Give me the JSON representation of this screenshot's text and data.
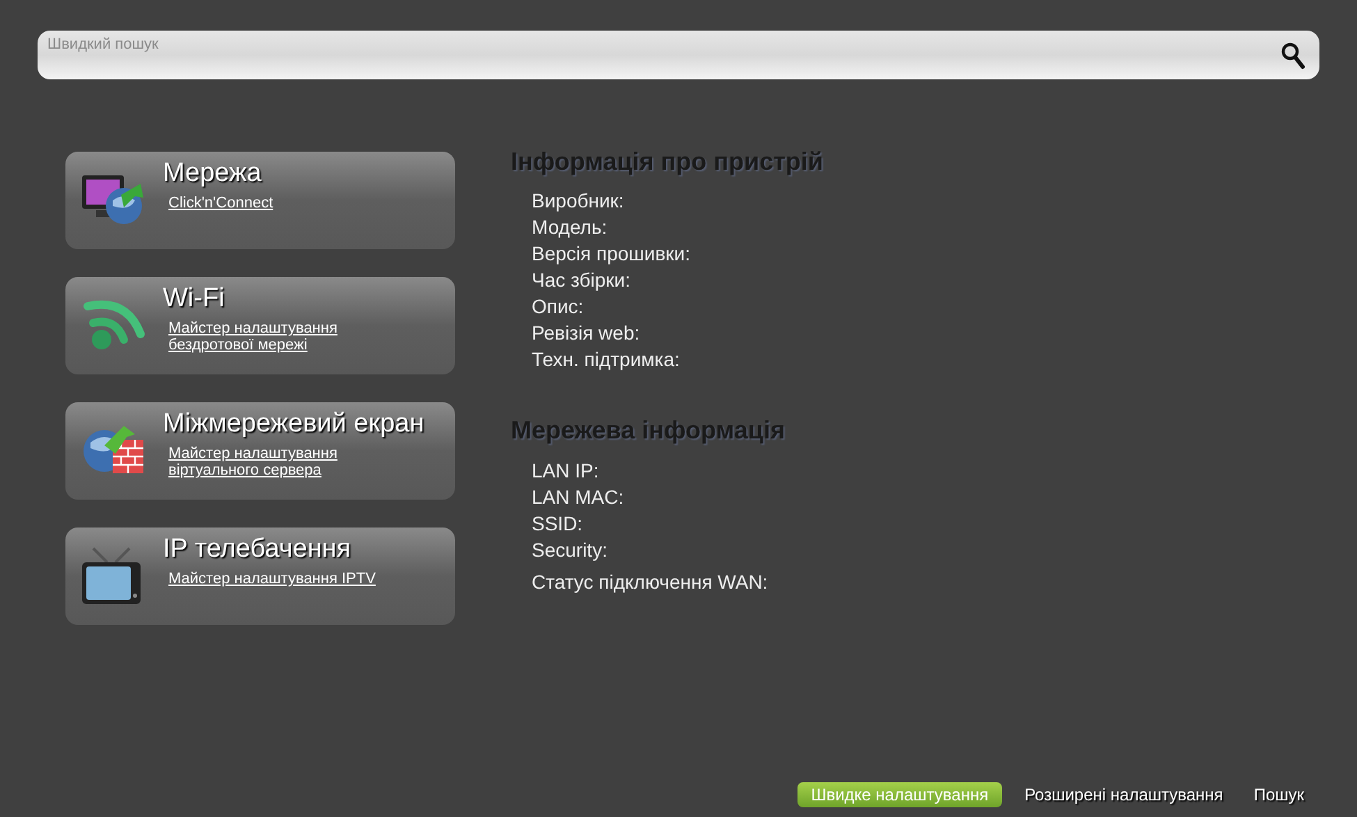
{
  "search": {
    "placeholder": "Швидкий пошук"
  },
  "cards": [
    {
      "kind": "network",
      "title": "Мережа",
      "link": "Click'n'Connect"
    },
    {
      "kind": "wifi",
      "title": "Wi-Fi",
      "link": "Майстер налаштування бездротової мережі"
    },
    {
      "kind": "firewall",
      "title": "Міжмережевий екран",
      "link": "Майстер налаштування віртуального сервера"
    },
    {
      "kind": "tv",
      "title": "IP телебачення",
      "link": "Майстер налаштування IPTV"
    }
  ],
  "sections": [
    {
      "title": "Інформація про пристрій",
      "fields": [
        "Виробник:",
        "Модель:",
        "Версія прошивки:",
        "Час збірки:",
        "Опис:",
        "Ревізія web:",
        "Техн. підтримка:"
      ]
    },
    {
      "title": "Мережева інформація",
      "fields": [
        "LAN IP:",
        "LAN MAC:",
        "SSID:",
        "Security:",
        "Статус підключення WAN:"
      ]
    }
  ],
  "footer_nav": [
    {
      "label": "Швидке налаштування",
      "selected": true
    },
    {
      "label": "Розширені налаштування",
      "selected": false
    },
    {
      "label": "Пошук",
      "selected": false
    }
  ]
}
